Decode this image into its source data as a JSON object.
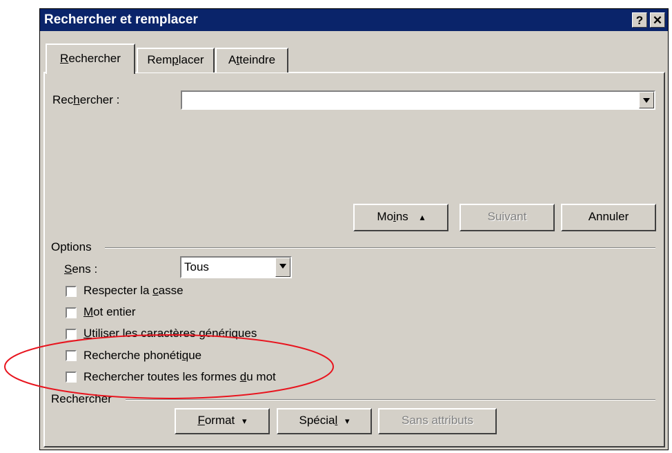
{
  "dialog": {
    "title": "Rechercher et remplacer",
    "help_button": "?",
    "close_button": "✕"
  },
  "tabs": [
    {
      "pre": "",
      "key": "R",
      "post": "echercher"
    },
    {
      "pre": "Rem",
      "key": "p",
      "post": "lacer"
    },
    {
      "pre": "A",
      "key": "t",
      "post": "teindre"
    }
  ],
  "find": {
    "label_pre": "Rec",
    "label_key": "h",
    "label_post": "ercher :",
    "value": ""
  },
  "buttons": {
    "less_pre": "Mo",
    "less_key": "i",
    "less_post": "ns",
    "less_icon": "▴",
    "next": "Suivant",
    "cancel": "Annuler"
  },
  "options": {
    "group_label": "Options",
    "direction_key": "S",
    "direction_post": "ens :",
    "direction_value": "Tous",
    "checkboxes": [
      {
        "pre": "Respecter la ",
        "key": "c",
        "post": "asse",
        "checked": false
      },
      {
        "pre": "",
        "key": "M",
        "post": "ot entier",
        "checked": false
      },
      {
        "pre": "",
        "key": "U",
        "post": "tiliser les caractères génériques",
        "checked": false
      },
      {
        "pre": "Recherche phonéti",
        "key": "q",
        "post": "ue",
        "checked": false
      },
      {
        "pre": "Rechercher toutes les formes ",
        "key": "d",
        "post": "u mot",
        "checked": false
      }
    ]
  },
  "search_group": {
    "label": "Rechercher",
    "format_key": "F",
    "format_post": "ormat",
    "special_pre": "Spécia",
    "special_key": "l",
    "special_post": "",
    "no_attributes": "Sans attributs",
    "dropdown_glyph": "▾"
  },
  "annotation": {
    "color": "#e8141e"
  }
}
